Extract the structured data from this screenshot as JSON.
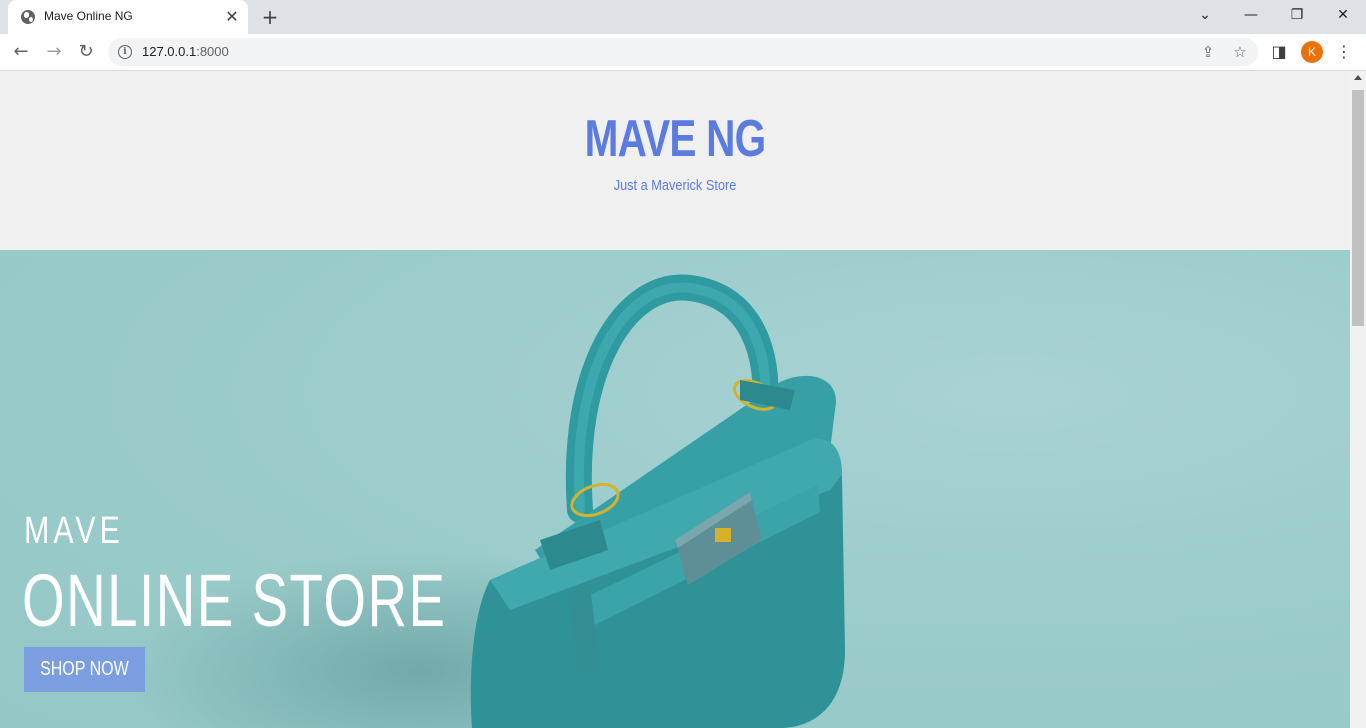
{
  "browser": {
    "tab_title": "Mave Online NG",
    "tab_close": "✕",
    "new_tab": "+",
    "url_host": "127.0.0.1",
    "url_port": ":8000",
    "profile_initial": "K",
    "controls": {
      "tab_search": "⌄",
      "minimize": "—",
      "restore": "❐",
      "close": "✕"
    },
    "nav": {
      "back": "←",
      "forward": "→",
      "reload": "↻"
    },
    "icons": {
      "share": "⇪",
      "bookmark": "☆",
      "side_panel": "◨",
      "menu": "⋮"
    }
  },
  "site": {
    "brand": "MAVE NG",
    "tagline": "Just a Maverick Store"
  },
  "hero": {
    "kicker": "MAVE",
    "title": "ONLINE STORE",
    "cta_label": "SHOP NOW",
    "image": "teal-handbag"
  },
  "colors": {
    "brand": "#5b7be0",
    "hero_bg": "#9ccccc",
    "cta_bg": "#7a9ee0",
    "bag": "#3aa3a8",
    "hardware": "#d4b22a"
  }
}
